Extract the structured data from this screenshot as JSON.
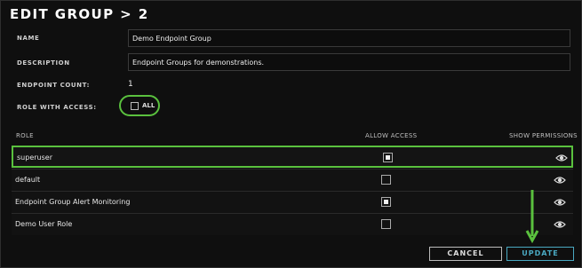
{
  "header": {
    "title": "EDIT GROUP > 2"
  },
  "form": {
    "name_label": "NAME",
    "name_value": "Demo Endpoint Group",
    "description_label": "DESCRIPTION",
    "description_value": "Endpoint Groups for demonstrations.",
    "endpoint_count_label": "ENDPOINT COUNT:",
    "endpoint_count_value": "1",
    "role_access_label": "ROLE WITH ACCESS:",
    "all_label": "ALL"
  },
  "table": {
    "col_role": "ROLE",
    "col_allow": "ALLOW ACCESS",
    "col_show": "SHOW PERMISSIONS",
    "rows": [
      {
        "role": "superuser",
        "allow": true
      },
      {
        "role": "default",
        "allow": false
      },
      {
        "role": "Endpoint Group Alert Monitoring",
        "allow": true
      },
      {
        "role": "Demo User Role",
        "allow": false
      }
    ]
  },
  "footer": {
    "cancel_label": "CANCEL",
    "update_label": "UPDATE"
  },
  "colors": {
    "highlight": "#5ac13e",
    "update": "#4aa9c2"
  },
  "icons": {
    "show_permission": "eye-icon",
    "annotation": "arrow-down-icon"
  }
}
